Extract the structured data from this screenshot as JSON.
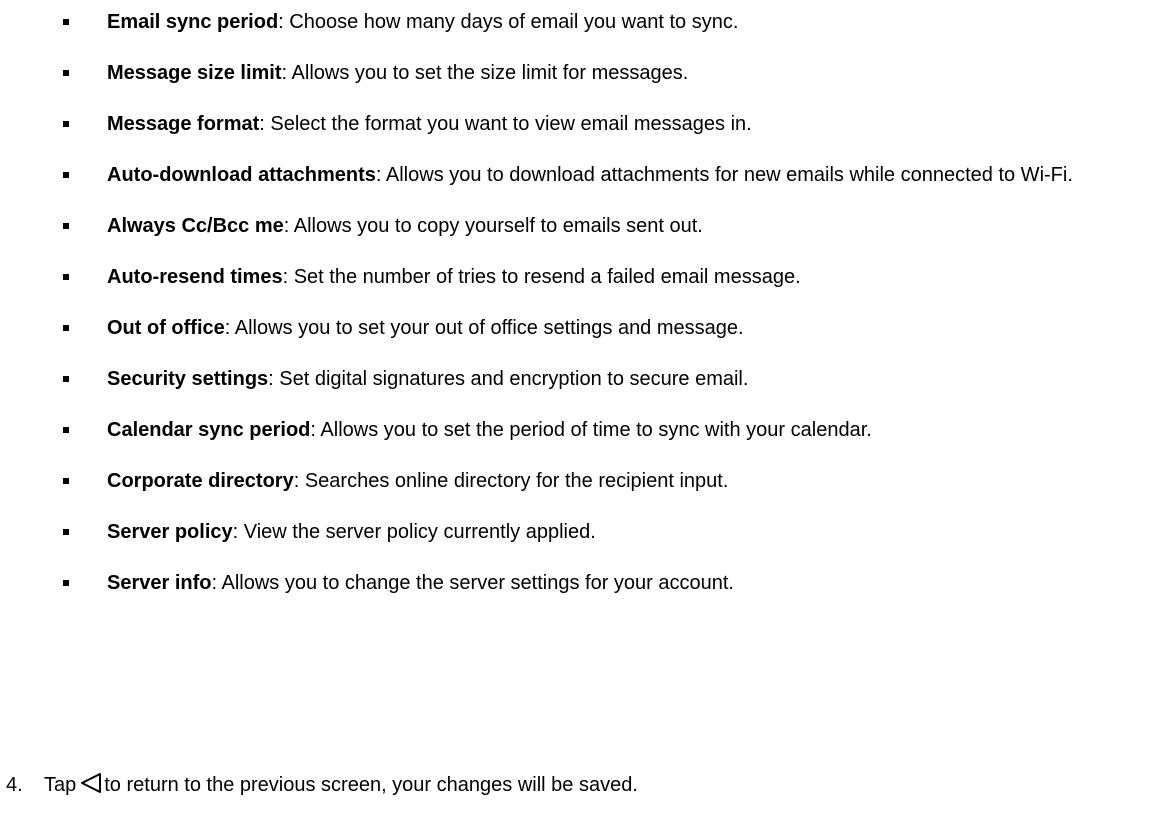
{
  "settings": [
    {
      "term": "Email sync period",
      "desc": ": Choose how many days of email you want to sync."
    },
    {
      "term": "Message size limit",
      "desc": ": Allows you to set the size limit for messages."
    },
    {
      "term": "Message format",
      "desc": ": Select the format you want to view email messages in."
    },
    {
      "term": "Auto-download attachments",
      "desc": ": Allows you to download attachments for new emails while connected to Wi-Fi."
    },
    {
      "term": "Always Cc/Bcc me",
      "desc": ": Allows you to copy yourself to emails sent out."
    },
    {
      "term": "Auto-resend times",
      "desc": ": Set the number of tries to resend a failed email message."
    },
    {
      "term": "Out of office",
      "desc": ": Allows you to set your out of office settings and message."
    },
    {
      "term": "Security settings",
      "desc": ": Set digital signatures and encryption to secure email."
    },
    {
      "term": "Calendar sync period",
      "desc": ": Allows you to set the period of time to sync with your calendar."
    },
    {
      "term": "Corporate directory",
      "desc": ": Searches online directory for the recipient input."
    },
    {
      "term": "Server policy",
      "desc": ": View the server policy currently applied."
    },
    {
      "term": "Server info",
      "desc": ": Allows you to change the server settings for your account."
    }
  ],
  "step": {
    "number": "4.",
    "before_icon": "Tap",
    "icon": "back-triangle-icon",
    "after_icon": "to return to the previous screen, your changes will be saved."
  }
}
